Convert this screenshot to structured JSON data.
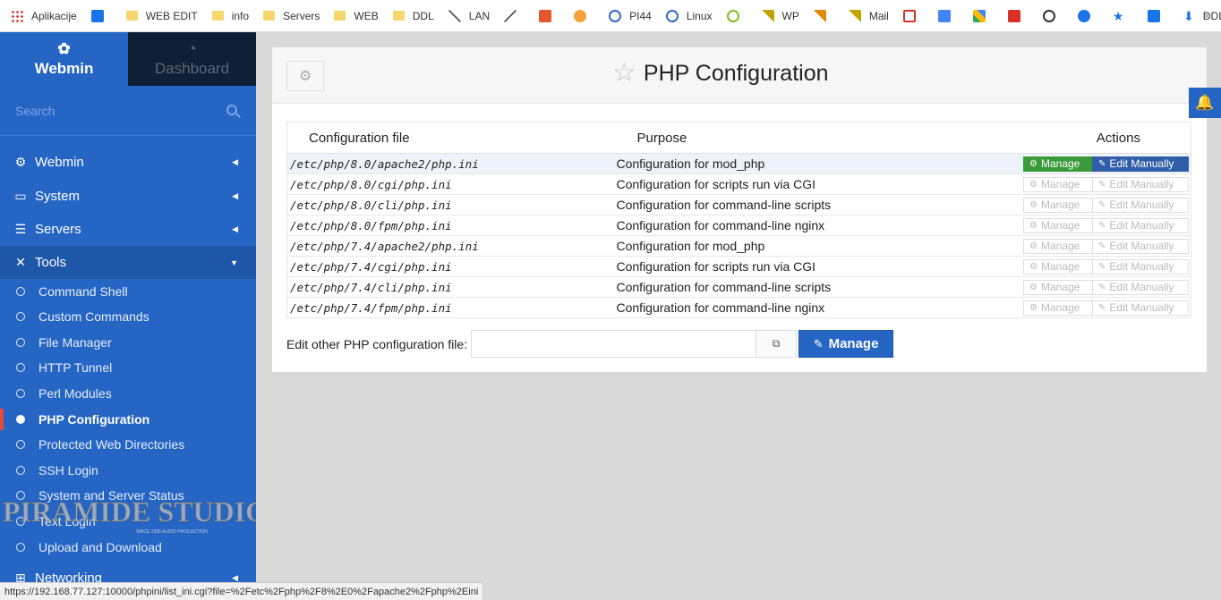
{
  "bookmarks": [
    "Aplikacije",
    "",
    "WEB EDIT",
    "info",
    "Servers",
    "WEB",
    "DDL",
    "LAN",
    "",
    "",
    "",
    "PI44",
    "Linux",
    "",
    "WP",
    "",
    "Mail",
    "",
    "",
    "",
    "",
    "",
    "",
    "",
    "",
    "DDLWEB"
  ],
  "bookmarks_more": "»",
  "sidebar": {
    "tab_webmin": "Webmin",
    "tab_dashboard": "Dashboard",
    "search_placeholder": "Search",
    "categories": [
      {
        "label": "Webmin"
      },
      {
        "label": "System"
      },
      {
        "label": "Servers"
      },
      {
        "label": "Tools"
      },
      {
        "label": "Networking"
      }
    ],
    "tools_items": [
      {
        "label": "Command Shell"
      },
      {
        "label": "Custom Commands"
      },
      {
        "label": "File Manager"
      },
      {
        "label": "HTTP Tunnel"
      },
      {
        "label": "Perl Modules"
      },
      {
        "label": "PHP Configuration"
      },
      {
        "label": "Protected Web Directories"
      },
      {
        "label": "SSH Login"
      },
      {
        "label": "System and Server Status"
      },
      {
        "label": "Text Login"
      },
      {
        "label": "Upload and Download"
      }
    ]
  },
  "watermark": {
    "text": "PIRAMIDE STUDIO",
    "small": "SINCE 1995 AUDIO PRODUCTION"
  },
  "page": {
    "title": "PHP Configuration",
    "columns": [
      "Configuration file",
      "Purpose",
      "Actions"
    ],
    "rows": [
      {
        "file": "/etc/php/8.0/apache2/php.ini",
        "purpose": "Configuration for mod_php"
      },
      {
        "file": "/etc/php/8.0/cgi/php.ini",
        "purpose": "Configuration for scripts run via CGI"
      },
      {
        "file": "/etc/php/8.0/cli/php.ini",
        "purpose": "Configuration for command-line scripts"
      },
      {
        "file": "/etc/php/8.0/fpm/php.ini",
        "purpose": "Configuration for command-line nginx"
      },
      {
        "file": "/etc/php/7.4/apache2/php.ini",
        "purpose": "Configuration for mod_php"
      },
      {
        "file": "/etc/php/7.4/cgi/php.ini",
        "purpose": "Configuration for scripts run via CGI"
      },
      {
        "file": "/etc/php/7.4/cli/php.ini",
        "purpose": "Configuration for command-line scripts"
      },
      {
        "file": "/etc/php/7.4/fpm/php.ini",
        "purpose": "Configuration for command-line nginx"
      }
    ],
    "manage_label": "Manage",
    "edit_label": "Edit Manually",
    "other_label": "Edit other PHP configuration file:",
    "other_value": "",
    "other_button": "Manage"
  },
  "status_url": "https://192.168.77.127:10000/phpini/list_ini.cgi?file=%2Fetc%2Fphp%2F8%2E0%2Fapache2%2Fphp%2Eini"
}
